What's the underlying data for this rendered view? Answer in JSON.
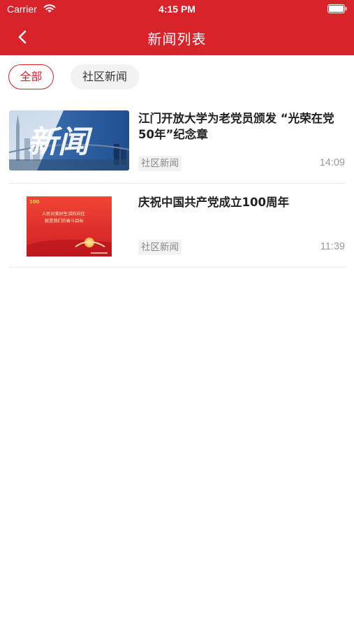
{
  "status_bar": {
    "carrier": "Carrier",
    "time": "4:15 PM"
  },
  "nav": {
    "title": "新闻列表",
    "back_icon": "chevron-left-icon"
  },
  "filters": [
    {
      "label": "全部",
      "active": true
    },
    {
      "label": "社区新闻",
      "active": false
    }
  ],
  "news": [
    {
      "title": "江门开放大学为老党员颁发 “光荣在党50年”纪念章",
      "tag": "社区新闻",
      "time": "14:09",
      "thumb_text": "新闻"
    },
    {
      "title": "庆祝中国共产党成立100周年",
      "tag": "社区新闻",
      "time": "11:39",
      "thumb_lines": [
        "人民对美好生活的向往",
        "就是我们的奋斗目标"
      ]
    }
  ],
  "colors": {
    "brand_red": "#d9232b",
    "divider": "#e9e9e9",
    "chip_bg": "#f2f2f2"
  }
}
